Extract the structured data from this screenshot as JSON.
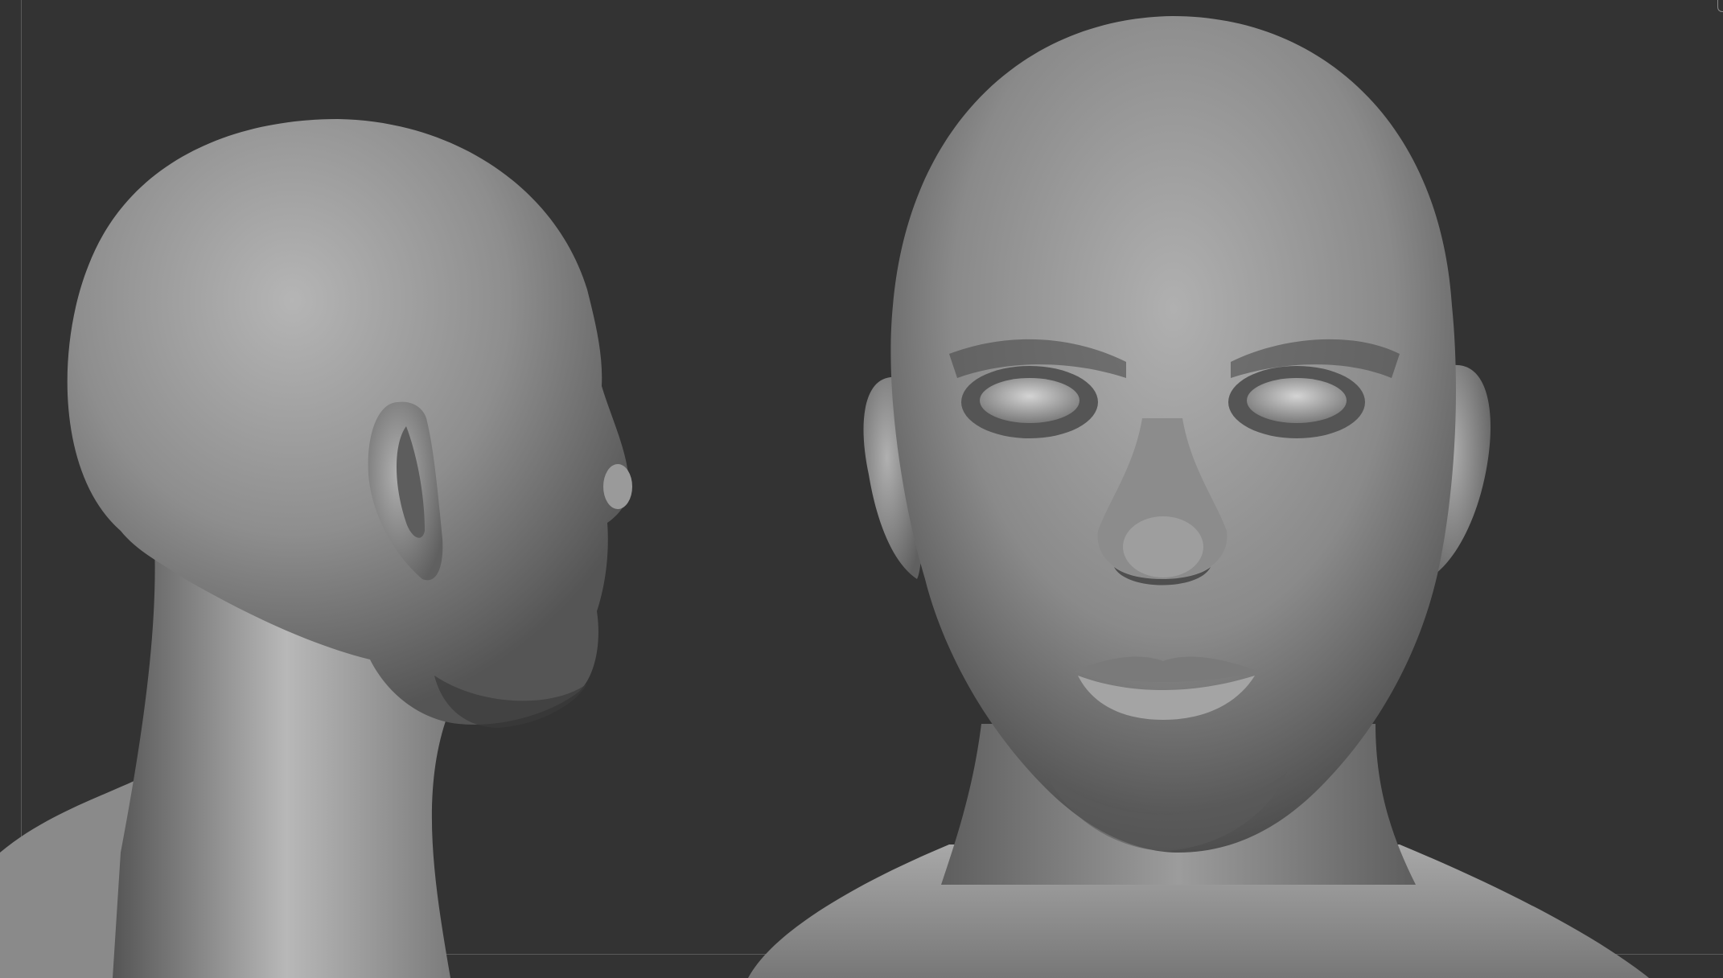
{
  "viewport": {
    "background_color": "#333333",
    "frame_color": "#5a5a5a",
    "material_color": "#9a9a9a"
  },
  "models": [
    {
      "name": "side-profile-head",
      "view": "profile"
    },
    {
      "name": "front-view-head",
      "view": "front"
    }
  ],
  "icons": {
    "corner": "corner-bracket-icon"
  }
}
